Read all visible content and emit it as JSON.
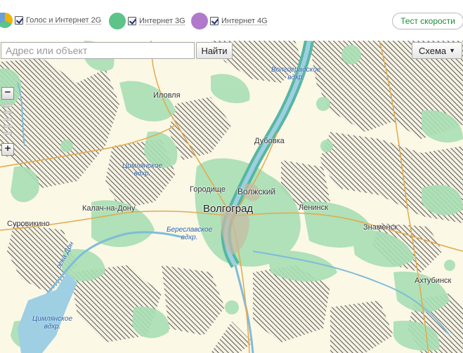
{
  "legend": {
    "items": [
      {
        "label": "Голос и Интернет 2G",
        "color": "#f0b400",
        "checked": true
      },
      {
        "label": "Интернет 3G",
        "color": "#5cc489",
        "checked": true
      },
      {
        "label": "Интернет 4G",
        "color": "#b07acb",
        "checked": true
      }
    ],
    "speed_test_label": "Тест скорости"
  },
  "map": {
    "search": {
      "placeholder": "Адрес или объект",
      "value": "",
      "button_label": "Найти"
    },
    "layer": {
      "selected": "Схема"
    },
    "zoom": {
      "minus": "−",
      "plus": "+"
    },
    "places": {
      "volgograd": "Волгоград",
      "volzhsky": "Волжский",
      "gorodishche": "Городище",
      "ilovlya": "Иловля",
      "dubovka": "Дубовка",
      "leninsk": "Ленинск",
      "znamensk": "Знаменск",
      "akhtubinsk": "Ахтубинск",
      "kalach": "Калач-на-Дону",
      "surovikino": "Суровикино"
    },
    "water": {
      "volgograd_res": [
        "Волгоградское",
        "вдхр."
      ],
      "tsimlyansk_top": [
        "Цимлянское",
        "вдхр."
      ],
      "bereslavka": [
        "Береславское",
        "вдхр."
      ],
      "tsimlyansk_bottom": [
        "Цимлянское",
        "вдхр."
      ],
      "don_river": "река Дон"
    }
  }
}
